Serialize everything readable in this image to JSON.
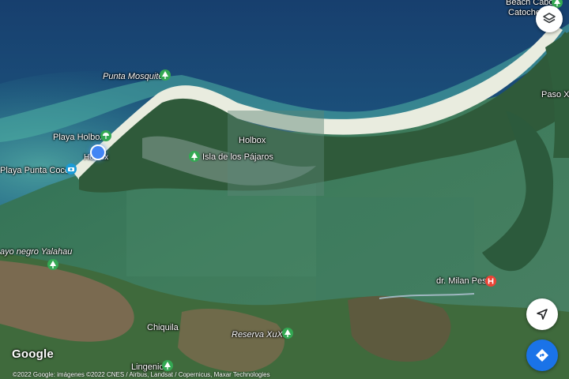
{
  "map": {
    "labels": {
      "beach_cabo": "Beach Cabo",
      "catoche": "Catoche",
      "punta_mosquito": "Punta Mosquito",
      "paso_xo": "Paso Xo",
      "playa_holbox": "Playa Holbox",
      "holbox_town": "Holbox",
      "holbox_area": "Holbox",
      "isla_pajaros": "Isla de los Pájaros",
      "playa_punta_cocos": "Playa Punta Cocos",
      "cayo_negro": "ayo negro Yalahau",
      "milan_pesic": "dr. Milan Pesic",
      "chiquila": "Chiquila",
      "reserva_xuxu": "Reserva XuXu",
      "lingenio": "Lingenio"
    },
    "pin_icons": {
      "park": "tree-pin-icon",
      "beach": "umbrella-pin-icon",
      "photo": "camera-pin-icon",
      "hospital": "hospital-pin-icon"
    },
    "colors": {
      "park_pin": "#34a853",
      "hospital_pin": "#ea4335",
      "location_dot": "#4285f4",
      "directions_fab": "#1a73e8"
    }
  },
  "branding": {
    "logo": "Google",
    "copyright": "©2022 Google: imágenes ©2022 CNES / Airbus, Landsat / Copernicus, Maxar Technologies"
  },
  "controls": {
    "layers_icon": "layers-icon",
    "my_location_icon": "navigation-arrow-icon",
    "directions_icon": "directions-icon"
  }
}
